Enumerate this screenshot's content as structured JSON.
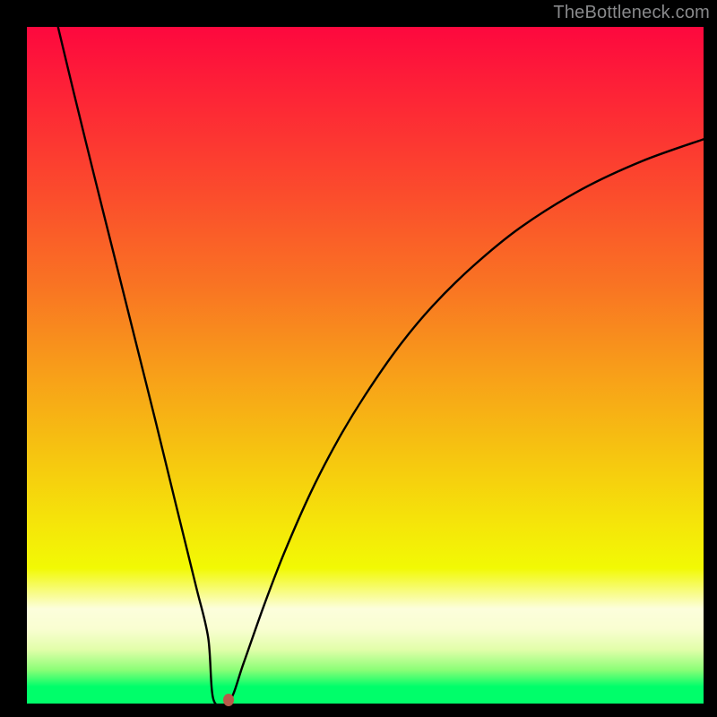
{
  "watermark": "TheBottleneck.com",
  "colors": {
    "background": "#000000",
    "curve": "#000000",
    "marker": "#b85a4a",
    "watermark": "#88898b",
    "gradient_stops": [
      {
        "offset": 0.0,
        "color": "#fd083e"
      },
      {
        "offset": 0.12,
        "color": "#fd2935"
      },
      {
        "offset": 0.25,
        "color": "#fb4d2c"
      },
      {
        "offset": 0.38,
        "color": "#f97323"
      },
      {
        "offset": 0.5,
        "color": "#f89b1a"
      },
      {
        "offset": 0.62,
        "color": "#f6c111"
      },
      {
        "offset": 0.74,
        "color": "#f5e709"
      },
      {
        "offset": 0.8,
        "color": "#f2f904"
      },
      {
        "offset": 0.86,
        "color": "#fcfedc"
      },
      {
        "offset": 0.89,
        "color": "#f9fed1"
      },
      {
        "offset": 0.92,
        "color": "#e2feaa"
      },
      {
        "offset": 0.95,
        "color": "#8cfe77"
      },
      {
        "offset": 0.975,
        "color": "#00fe6a"
      },
      {
        "offset": 1.0,
        "color": "#00fe6a"
      }
    ]
  },
  "chart_data": {
    "type": "line",
    "title": "",
    "xlabel": "",
    "ylabel": "",
    "xlim": [
      0,
      100
    ],
    "ylim": [
      0,
      100
    ],
    "legend": false,
    "grid": false,
    "annotations": [],
    "marker": {
      "x": 29.8,
      "y": 0.5
    },
    "series": [
      {
        "name": "curve",
        "x": [
          4.6,
          7,
          10,
          13,
          16,
          19,
          22,
          25,
          26.8,
          27.6,
          30,
          32,
          35,
          38,
          42,
          46,
          50,
          55,
          60,
          66,
          73,
          82,
          91,
          100
        ],
        "y": [
          100,
          90,
          77.8,
          65.8,
          53.8,
          41.8,
          29.5,
          17.3,
          9.7,
          0.5,
          0.5,
          5.9,
          14.4,
          22.2,
          31.3,
          39,
          45.6,
          52.8,
          58.8,
          64.7,
          70.4,
          76,
          80.2,
          83.4
        ]
      }
    ]
  }
}
